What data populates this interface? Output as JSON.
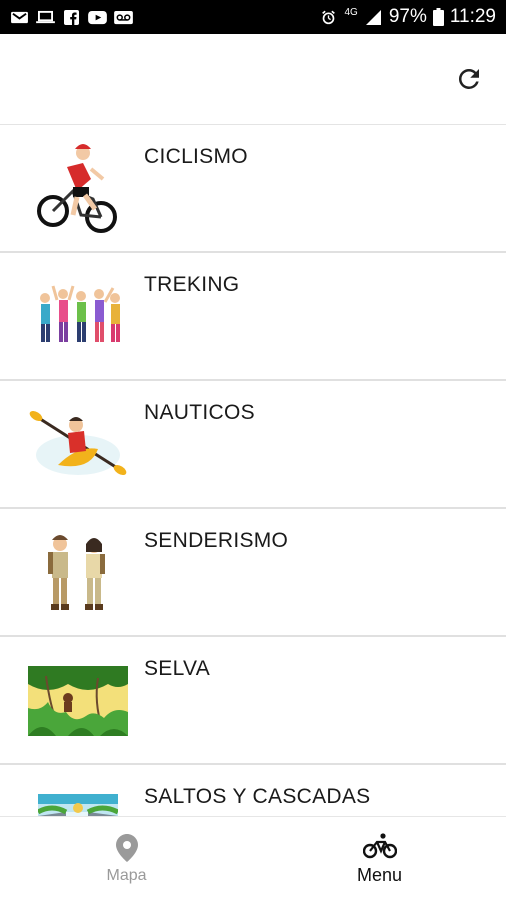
{
  "status_bar": {
    "left_icons": [
      "gmail-icon",
      "laptop-icon",
      "facebook-icon",
      "youtube-icon",
      "voicemail-icon"
    ],
    "right_icons": [
      "alarm-icon",
      "4g-signal-icon",
      "battery-icon"
    ],
    "network_label": "4G",
    "battery": "97%",
    "time": "11:29"
  },
  "app_bar": {
    "refresh_icon": "refresh-icon"
  },
  "categories": [
    {
      "label": "CICLISMO",
      "icon": "cyclist-image"
    },
    {
      "label": "TREKING",
      "icon": "trekking-group-image"
    },
    {
      "label": "NAUTICOS",
      "icon": "kayak-image"
    },
    {
      "label": "SENDERISMO",
      "icon": "hikers-image"
    },
    {
      "label": "SELVA",
      "icon": "jungle-image"
    },
    {
      "label": "SALTOS Y CASCADAS",
      "icon": "waterfall-image"
    }
  ],
  "bottom_nav": {
    "items": [
      {
        "label": "Mapa",
        "icon": "map-pin-icon",
        "active": false
      },
      {
        "label": "Menu",
        "icon": "bicycle-icon",
        "active": true
      }
    ]
  },
  "colors": {
    "status_bar_bg": "#000000",
    "background": "#ffffff",
    "divider": "#e0e0e0",
    "inactive_nav": "#9a9a9a",
    "active_nav": "#111111"
  }
}
